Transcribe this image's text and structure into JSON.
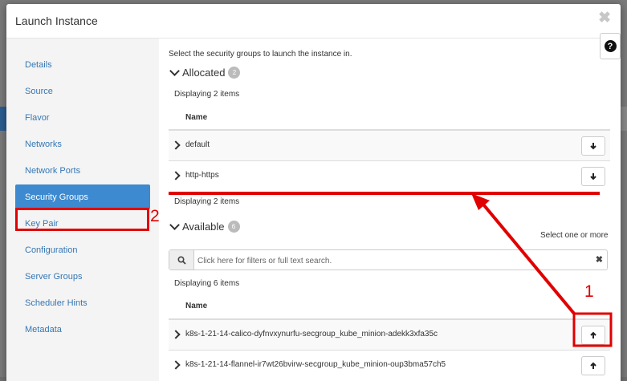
{
  "modal": {
    "title": "Launch Instance",
    "close_glyph": "✖",
    "help_glyph": "?"
  },
  "sidebar": {
    "items": [
      {
        "label": "Details"
      },
      {
        "label": "Source"
      },
      {
        "label": "Flavor"
      },
      {
        "label": "Networks"
      },
      {
        "label": "Network Ports"
      },
      {
        "label": "Security Groups",
        "active": true
      },
      {
        "label": "Key Pair"
      },
      {
        "label": "Configuration"
      },
      {
        "label": "Server Groups"
      },
      {
        "label": "Scheduler Hints"
      },
      {
        "label": "Metadata"
      }
    ]
  },
  "main": {
    "intro": "Select the security groups to launch the instance in.",
    "allocated": {
      "title": "Allocated",
      "count": "2",
      "displaying": "Displaying 2 items",
      "column": "Name",
      "rows": [
        {
          "name": "default"
        },
        {
          "name": "http-https"
        }
      ],
      "footer": "Displaying 2 items"
    },
    "available": {
      "title": "Available",
      "count": "6",
      "hint": "Select one or more",
      "search_placeholder": "Click here for filters or full text search.",
      "displaying": "Displaying 6 items",
      "column": "Name",
      "rows": [
        {
          "name": "k8s-1-21-14-calico-dyfnvxynurfu-secgroup_kube_minion-adekk3xfa35c"
        },
        {
          "name": "k8s-1-21-14-flannel-ir7wt26bvirw-secgroup_kube_minion-oup3bma57ch5"
        }
      ]
    }
  },
  "annotations": {
    "label_1": "1",
    "label_2": "2",
    "color": "#e10000"
  },
  "icons": {
    "down_arrow": "arrow-down-icon",
    "up_arrow": "arrow-up-icon",
    "search": "search-icon"
  }
}
